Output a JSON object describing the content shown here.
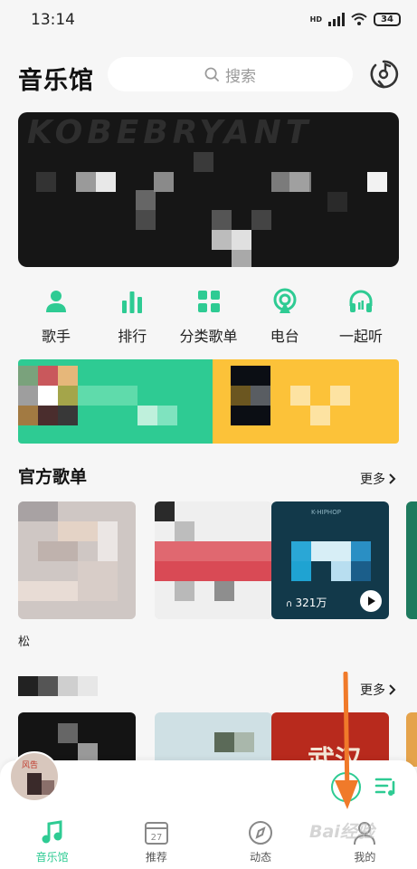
{
  "status_bar": {
    "time": "13:14",
    "network": "HD",
    "battery": "34"
  },
  "header": {
    "title": "音乐馆",
    "search_placeholder": "搜索"
  },
  "nav": [
    {
      "label": "歌手",
      "icon": "singer-icon"
    },
    {
      "label": "排行",
      "icon": "ranking-icon"
    },
    {
      "label": "分类歌单",
      "icon": "category-icon"
    },
    {
      "label": "电台",
      "icon": "radio-icon"
    },
    {
      "label": "一起听",
      "icon": "headphones-icon"
    }
  ],
  "banner": {
    "text": "KOBEBRYANT"
  },
  "official_playlists": {
    "title": "官方歌单",
    "more": "更多",
    "items": [
      {
        "caption": "松"
      },
      {
        "caption": ""
      },
      {
        "label": "K-HIPHOP",
        "play_count": "321万"
      }
    ]
  },
  "second_section": {
    "more": "更多",
    "cover_text": "武汉"
  },
  "mini_player": {
    "avatar_text": "风告"
  },
  "tabs": [
    {
      "label": "音乐馆",
      "icon": "music-note-icon",
      "active": true
    },
    {
      "label": "推荐",
      "icon": "calendar-icon",
      "badge": "27",
      "active": false
    },
    {
      "label": "动态",
      "icon": "compass-icon",
      "active": false
    },
    {
      "label": "我的",
      "icon": "profile-icon",
      "active": false
    }
  ],
  "watermark": "Bai经验",
  "colors": {
    "accent": "#2ecb93",
    "promo_yellow": "#fcc239",
    "annotation_arrow": "#f07a2a"
  }
}
